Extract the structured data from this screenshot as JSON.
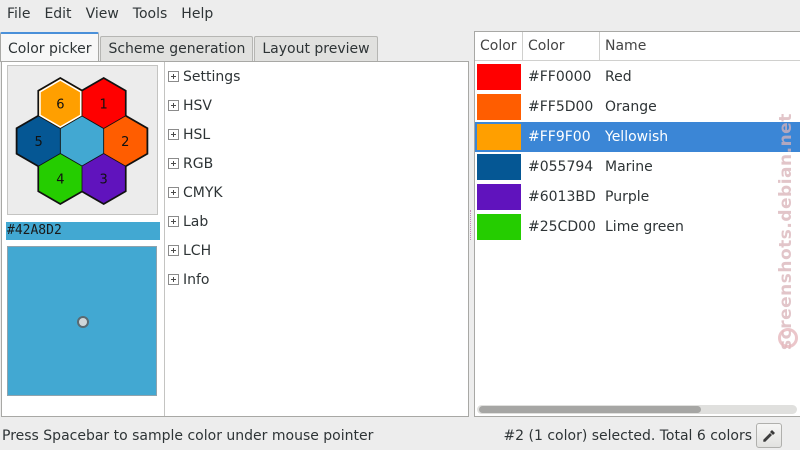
{
  "menubar": {
    "items": [
      "File",
      "Edit",
      "View",
      "Tools",
      "Help"
    ]
  },
  "tabs": [
    {
      "label": "Color picker",
      "active": true
    },
    {
      "label": "Scheme generation",
      "active": false
    },
    {
      "label": "Layout preview",
      "active": false
    }
  ],
  "picker": {
    "hex_value": "#42A8D2",
    "preview_color": "#42A8D2",
    "swatches": [
      {
        "label": "6",
        "color": "#FF9F00"
      },
      {
        "label": "1",
        "color": "#FF0000"
      },
      {
        "label": "5",
        "color": "#055794"
      },
      {
        "label": "2",
        "color": "#FF5D00"
      },
      {
        "label": "4",
        "color": "#25CD00"
      },
      {
        "label": "3",
        "color": "#6013BD"
      },
      {
        "label": "",
        "color": "#42A8D2"
      }
    ]
  },
  "tree": {
    "items": [
      "Settings",
      "HSV",
      "HSL",
      "RGB",
      "CMYK",
      "Lab",
      "LCH",
      "Info"
    ]
  },
  "palette": {
    "columns": [
      "Color",
      "Color",
      "Name"
    ],
    "rows": [
      {
        "color": "#FF0000",
        "hex": "#FF0000",
        "name": "Red",
        "selected": false
      },
      {
        "color": "#FF5D00",
        "hex": "#FF5D00",
        "name": "Orange",
        "selected": false
      },
      {
        "color": "#FF9F00",
        "hex": "#FF9F00",
        "name": "Yellowish",
        "selected": true
      },
      {
        "color": "#055794",
        "hex": "#055794",
        "name": "Marine",
        "selected": false
      },
      {
        "color": "#6013BD",
        "hex": "#6013BD",
        "name": "Purple",
        "selected": false
      },
      {
        "color": "#25CD00",
        "hex": "#25CD00",
        "name": "Lime green",
        "selected": false
      }
    ]
  },
  "status": {
    "left": "Press Spacebar to sample color under mouse pointer",
    "right": "#2 (1 color) selected. Total 6 colors",
    "sample_icon": "eyedropper-icon"
  },
  "watermark": {
    "text": "screenshots.debian.net"
  }
}
